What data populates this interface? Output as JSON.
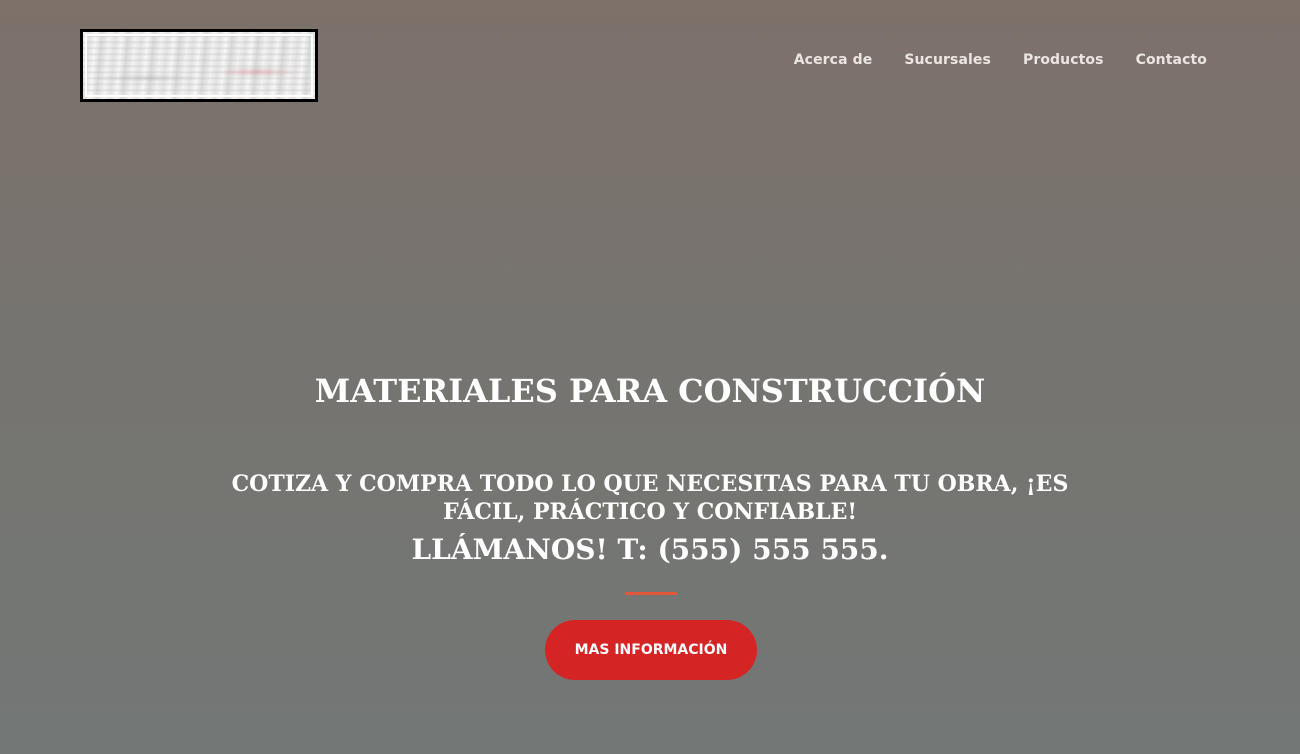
{
  "header": {
    "logo_icon": "company-logo",
    "nav": [
      {
        "label": "Acerca de"
      },
      {
        "label": "Sucursales"
      },
      {
        "label": "Productos"
      },
      {
        "label": "Contacto"
      }
    ]
  },
  "hero": {
    "title": "MATERIALES PARA CONSTRUCCIÓN",
    "subtitle": "COTIZA Y COMPRA TODO LO QUE NECESITAS PARA TU OBRA, ¡ES FÁCIL, PRÁCTICO Y CONFIABLE!",
    "phone": "LLÁMANOS! T: (555) 555 555.",
    "cta_label": "MAS INFORMACIÓN"
  },
  "colors": {
    "accent": "#d42424",
    "divider": "#e0573a",
    "text": "#ffffff"
  }
}
